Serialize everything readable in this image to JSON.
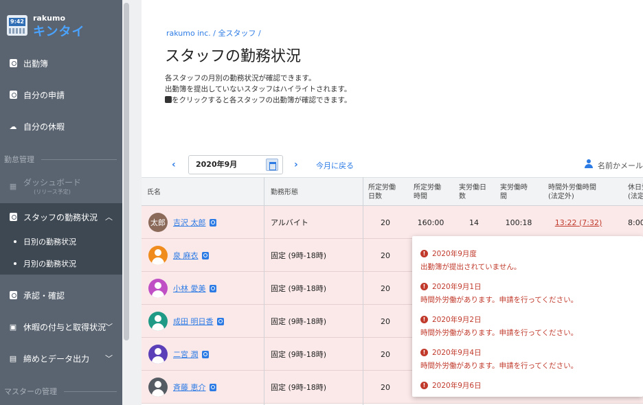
{
  "app": {
    "logo_small": "rakumo",
    "logo_big": "キンタイ",
    "logo_clock": "9:42"
  },
  "sidebar": {
    "items": [
      {
        "label": "出勤簿"
      },
      {
        "label": "自分の申請"
      },
      {
        "label": "自分の休暇"
      }
    ],
    "section_attendance": "勤怠管理",
    "dashboard": {
      "label": "ダッシュボード",
      "sub": "(リリース予定)"
    },
    "staff_status": {
      "label": "スタッフの勤務状況"
    },
    "sub_items": [
      {
        "label": "日別の勤務状況"
      },
      {
        "label": "月別の勤務状況"
      }
    ],
    "approval": {
      "label": "承認・確認"
    },
    "leave": {
      "label": "休暇の付与と取得状況"
    },
    "closing": {
      "label": "締めとデータ出力"
    },
    "section_master": "マスターの管理"
  },
  "main": {
    "breadcrumb": "rakumo inc.  /  全スタッフ  /",
    "title": "スタッフの勤務状況",
    "desc_line1": "各スタッフの月別の勤務状況が確認できます。",
    "desc_line2": "出勤簿を提出していないスタッフはハイライトされます。",
    "desc_line3": "をクリックすると各スタッフの出勤簿が確認できます。"
  },
  "toolbar": {
    "prev": "‹",
    "month": "2020年9月",
    "next": "›",
    "today": "今月に戻る",
    "search_placeholder": "名前かメール"
  },
  "table": {
    "headers": {
      "name": "氏名",
      "work_type": "勤務形態",
      "scheduled_days": "所定労働\n日数",
      "scheduled_hours": "所定労働\n時間",
      "actual_days": "実労働日\n数",
      "actual_hours": "実労働時\n間",
      "overtime": "時間外労働時間\n(法定外)",
      "holiday": "休日労\n(法定"
    },
    "rows": [
      {
        "avatar": "太郎",
        "name": "吉沢 太郎",
        "work_type": "アルバイト",
        "scheduled_days": "20",
        "scheduled_hours": "160:00",
        "actual_days": "14",
        "actual_hours": "100:18",
        "overtime": "13:22 (7:32)",
        "holiday": "8:00"
      },
      {
        "name": "泉 麻衣",
        "work_type": "固定 (9時-18時)",
        "scheduled_days": "20",
        "avatar_color": "#f08c1e"
      },
      {
        "name": "小林 愛美",
        "work_type": "固定 (9時-18時)",
        "scheduled_days": "20",
        "avatar_color": "#c04fc6"
      },
      {
        "name": "成田 明日香",
        "work_type": "固定 (9時-18時)",
        "scheduled_days": "20",
        "avatar_color": "#1e9a86"
      },
      {
        "name": "二宮 潤",
        "work_type": "固定 (9時-18時)",
        "scheduled_days": "20",
        "avatar_color": "#5a3fb8"
      },
      {
        "name": "斉藤 恵介",
        "work_type": "固定 (9時-18時)",
        "scheduled_days": "20",
        "avatar_color": "#555b62"
      }
    ]
  },
  "popup": {
    "alerts": [
      {
        "date": "2020年9月度",
        "message": "出勤簿が提出されていません。"
      },
      {
        "date": "2020年9月1日",
        "message": "時間外労働があります。申請を行ってください。"
      },
      {
        "date": "2020年9月2日",
        "message": "時間外労働があります。申請を行ってください。"
      },
      {
        "date": "2020年9月4日",
        "message": "時間外労働があります。申請を行ってください。"
      },
      {
        "date": "2020年9月6日",
        "message": ""
      }
    ]
  }
}
